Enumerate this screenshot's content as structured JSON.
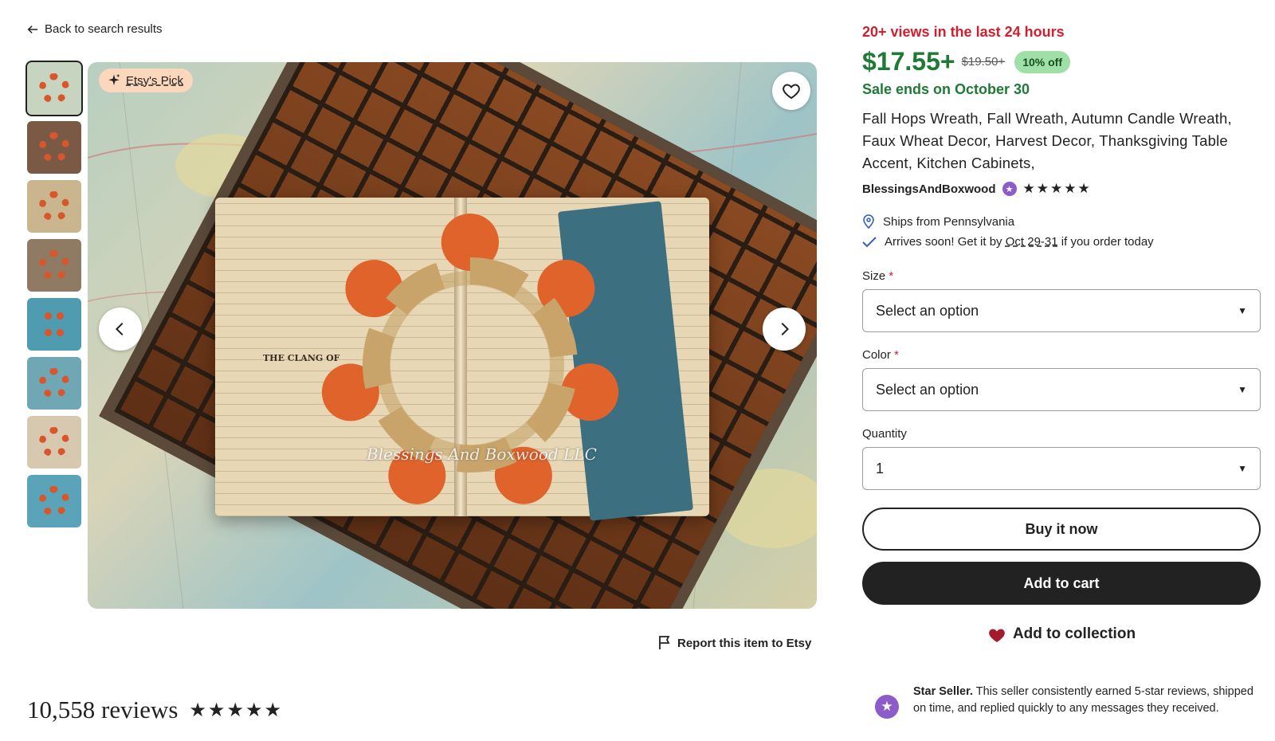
{
  "nav": {
    "back_label": "Back to search results"
  },
  "gallery": {
    "thumbnail_count": 8,
    "active_index": 0,
    "badge_label": "Etsy's Pick",
    "watermark": "Blessings And Boxwood LLC",
    "book_text_1": "THE CLANG OF"
  },
  "report": {
    "label": "Report this item to Etsy"
  },
  "reviews": {
    "count_label": "10,558 reviews",
    "rating": 5
  },
  "listing": {
    "views_label": "20+ views in the last 24 hours",
    "price": "$17.55+",
    "original_price": "$19.50+",
    "discount": "10% off",
    "sale_label": "Sale ends on October 30",
    "title": "Fall Hops Wreath, Fall Wreath, Autumn Candle Wreath, Faux Wheat Decor, Harvest Decor, Thanksgiving Table Accent, Kitchen Cabinets,",
    "shop_name": "BlessingsAndBoxwood",
    "shop_rating": 5,
    "ships_from": "Ships from Pennsylvania",
    "arrival_prefix": "Arrives soon! Get it by ",
    "arrival_dates": "Oct 29-31",
    "arrival_suffix": " if you order today"
  },
  "options": {
    "size_label": "Size",
    "size_value": "Select an option",
    "color_label": "Color",
    "color_value": "Select an option",
    "quantity_label": "Quantity",
    "quantity_value": "1",
    "required_mark": "*"
  },
  "actions": {
    "buy_now": "Buy it now",
    "add_to_cart": "Add to cart",
    "add_to_collection": "Add to collection"
  },
  "star_seller": {
    "title": "Star Seller.",
    "text": " This seller consistently earned 5-star reviews, shipped on time, and replied quickly to any messages they received."
  },
  "colors": {
    "sale_green": "#1f7a36",
    "alert_red": "#d0202f",
    "discount_bg": "#9fe0a6",
    "star_seller_purple": "#8c5cc9",
    "dark_button": "#222222",
    "heart_red": "#a61a2e"
  }
}
